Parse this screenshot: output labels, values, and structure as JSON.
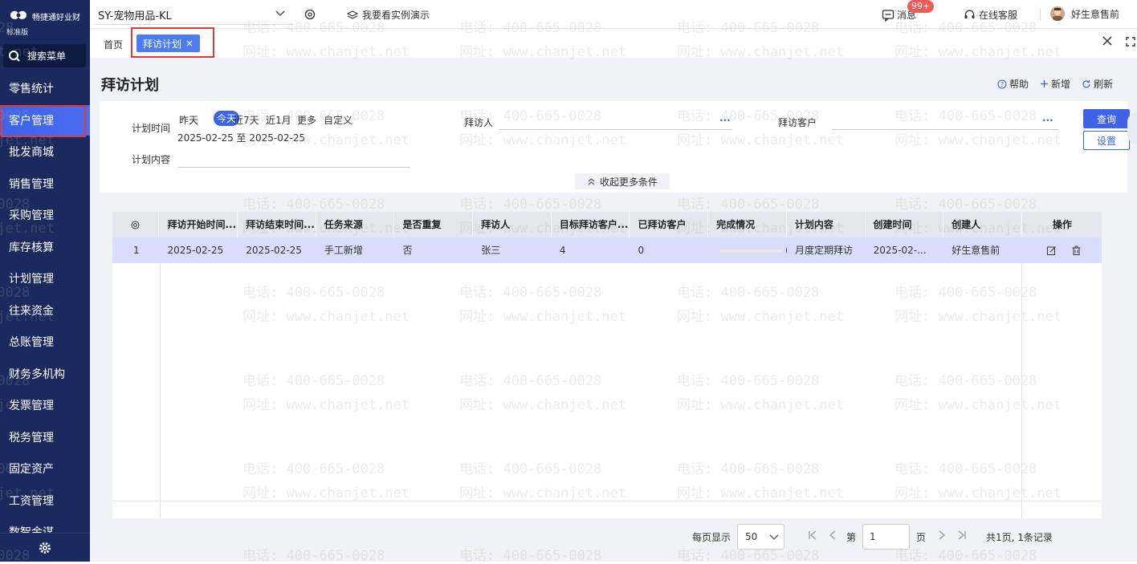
{
  "app": {
    "name": "畅捷通好业财",
    "edition": "标准版",
    "search_menu": "搜索菜单"
  },
  "sidebar": {
    "items": [
      {
        "label": "零售统计"
      },
      {
        "label": "客户管理"
      },
      {
        "label": "批发商城"
      },
      {
        "label": "销售管理"
      },
      {
        "label": "采购管理"
      },
      {
        "label": "库存核算"
      },
      {
        "label": "计划管理"
      },
      {
        "label": "往来资金"
      },
      {
        "label": "总账管理"
      },
      {
        "label": "财务多机构"
      },
      {
        "label": "发票管理"
      },
      {
        "label": "税务管理"
      },
      {
        "label": "固定资产"
      },
      {
        "label": "工资管理"
      },
      {
        "label": "数智金谋"
      }
    ],
    "active": "客户管理"
  },
  "topbar": {
    "company": "SY-宠物用品-KL",
    "demo": "我要看实例演示",
    "messages": "消息",
    "message_badge": "99+",
    "service": "在线客服",
    "user": "好生意售前"
  },
  "tabs": {
    "home": "首页",
    "active": "拜访计划",
    "active_close": "×"
  },
  "page": {
    "title": "拜访计划",
    "help": "帮助",
    "add": "新增",
    "refresh": "刷新"
  },
  "filter": {
    "plan_time_label": "计划时间",
    "quick": [
      "昨天",
      "今天",
      "近7天",
      "近1月",
      "更多",
      "自定义"
    ],
    "active_quick": "今天",
    "date_range": "2025-02-25 至 2025-02-25",
    "visitor_label": "拜访人",
    "customer_label": "拜访客户",
    "content_label": "计划内容",
    "query_button": "查询",
    "settings_button": "设置",
    "collapse": "收起更多条件",
    "more_dots": "..."
  },
  "table": {
    "columns": [
      "拜访开始时间...",
      "拜访结束时间...",
      "任务来源",
      "是否重复",
      "拜访人",
      "目标拜访客户...",
      "已拜访客户",
      "完成情况",
      "计划内容",
      "创建时间",
      "创建人",
      "操作"
    ],
    "rows": [
      {
        "index": "1",
        "start": "2025-02-25",
        "end": "2025-02-25",
        "source": "手工新增",
        "repeat": "否",
        "visitor": "张三",
        "target": "4",
        "visited": "0",
        "completion": "(",
        "content": "月度定期拜访",
        "created": "2025-02-...",
        "creator": "好生意售前"
      }
    ]
  },
  "pagination": {
    "per_page_label": "每页显示",
    "per_page": "50",
    "page_prefix": "第",
    "page": "1",
    "page_suffix": "页",
    "total": "共1页, 1条记录"
  },
  "watermark": {
    "phone": "电话: 400-665-0028",
    "site": "网址: www.chanjet.net"
  },
  "colors": {
    "sidebar": "#1b2a5e",
    "accent": "#3e63e8",
    "highlight_frame": "#e03b3b"
  }
}
